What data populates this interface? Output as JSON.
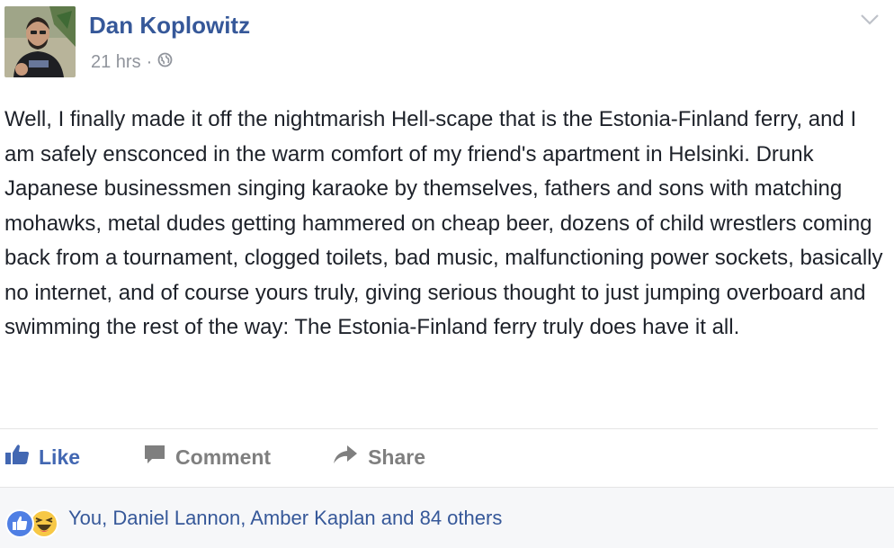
{
  "post": {
    "author": "Dan Koplowitz",
    "time": "21 hrs",
    "separator": "·",
    "privacy_icon": "globe-icon",
    "body": "Well, I finally made it off the nightmarish Hell-scape that is the Estonia-Finland ferry, and I am safely ensconced in the warm comfort of my friend's apartment in Helsinki. Drunk Japanese businessmen singing karaoke by themselves, fathers and sons with matching mohawks, metal dudes getting hammered on cheap beer, dozens of child wrestlers coming back from a tournament, clogged toilets, bad music, malfunctioning power sockets, basically no internet, and of course yours truly, giving serious thought to just jumping overboard and swimming the rest of the way: The Estonia-Finland ferry truly does have it all."
  },
  "actions": {
    "like": "Like",
    "comment": "Comment",
    "share": "Share"
  },
  "reactions": {
    "icons": [
      "like-reaction-icon",
      "haha-reaction-icon"
    ],
    "summary": "You, Daniel Lannon, Amber Kaplan and 84 others"
  },
  "colors": {
    "link": "#365899",
    "like_blue": "#4267b2",
    "text": "#1d2129",
    "muted": "#90949c",
    "footer_bg": "#f6f7f9"
  }
}
